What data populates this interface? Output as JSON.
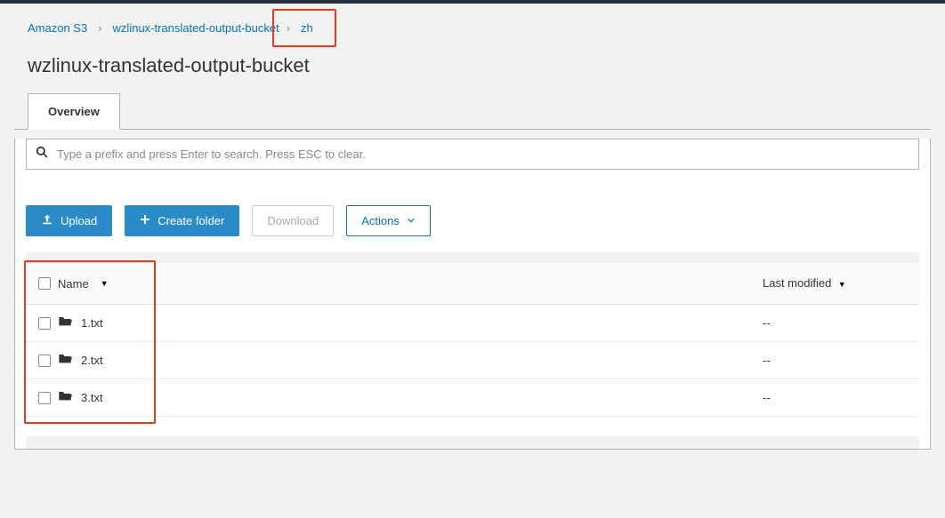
{
  "breadcrumb": {
    "root": "Amazon S3",
    "bucket": "wzlinux-translated-output-bucket",
    "folder": "zh"
  },
  "page_title": "wzlinux-translated-output-bucket",
  "tabs": {
    "overview": "Overview"
  },
  "search": {
    "placeholder": "Type a prefix and press Enter to search. Press ESC to clear."
  },
  "toolbar": {
    "upload": "Upload",
    "create_folder": "Create folder",
    "download": "Download",
    "actions": "Actions"
  },
  "table": {
    "headers": {
      "name": "Name",
      "last_modified": "Last modified"
    },
    "rows": [
      {
        "name": "1.txt",
        "last_modified": "--"
      },
      {
        "name": "2.txt",
        "last_modified": "--"
      },
      {
        "name": "3.txt",
        "last_modified": "--"
      }
    ]
  }
}
